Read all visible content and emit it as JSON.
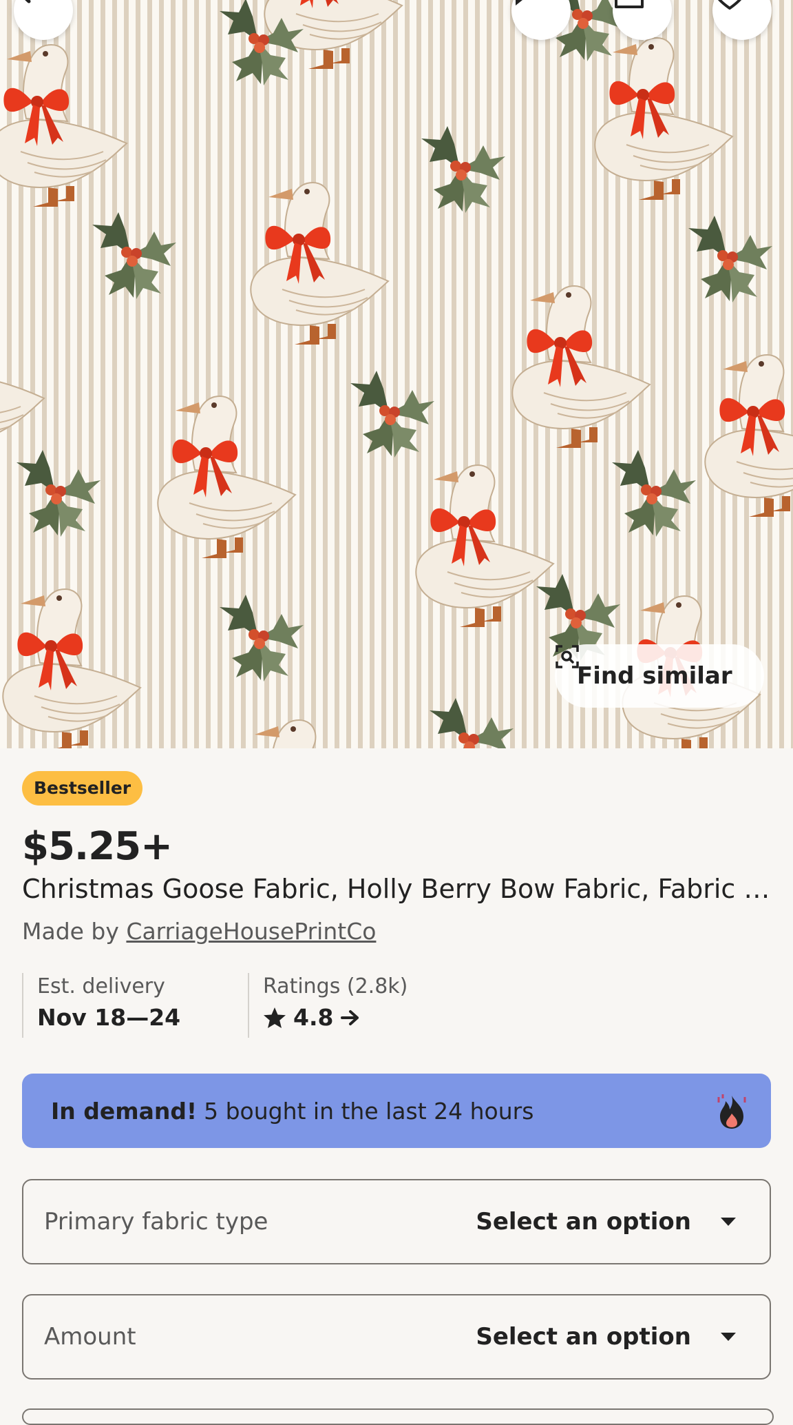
{
  "hero": {
    "find_similar_label": "Find similar",
    "icons": [
      "back-icon",
      "chat-icon",
      "share-icon",
      "heart-icon",
      "visual-search-icon"
    ]
  },
  "product": {
    "badge": "Bestseller",
    "price": "$5.25+",
    "title": "Christmas Goose Fabric, Holly Berry Bow Fabric, Fabric by...",
    "made_by_prefix": "Made by",
    "shop_name": "CarriageHousePrintCo"
  },
  "delivery": {
    "label": "Est. delivery",
    "value": "Nov 18—24"
  },
  "ratings": {
    "label": "Ratings (2.8k)",
    "value": "4.8",
    "icon": "star-icon"
  },
  "demand": {
    "bold": "In demand!",
    "text": "5 bought in the last 24 hours",
    "icon": "fire-icon"
  },
  "options": [
    {
      "label": "Primary fabric type",
      "value": "Select an option"
    },
    {
      "label": "Amount",
      "value": "Select an option"
    }
  ],
  "colors": {
    "badge": "#fdbe43",
    "demand_banner": "#7d96e6",
    "background": "#f8f6f3",
    "bow_red": "#e8391d"
  }
}
